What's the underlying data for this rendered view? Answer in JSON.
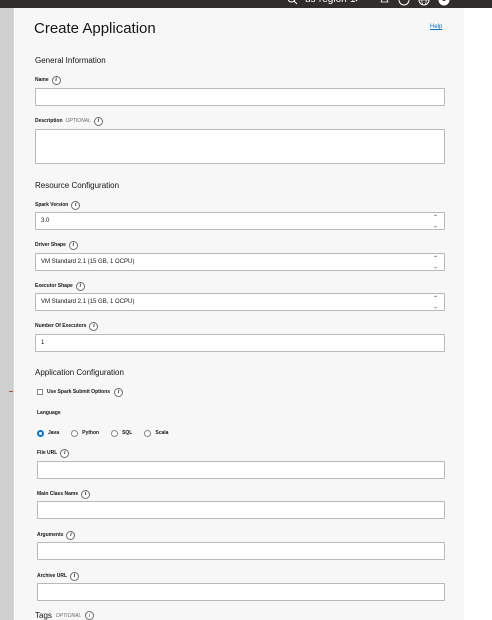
{
  "topbar": {
    "region": "us-region-1"
  },
  "page": {
    "title": "Create Application",
    "help": "Help"
  },
  "general": {
    "heading": "General Information",
    "name_label": "Name",
    "name_value": "",
    "description_label": "Description",
    "description_optional": "OPTIONAL",
    "description_value": ""
  },
  "resource": {
    "heading": "Resource Configuration",
    "spark_version_label": "Spark Version",
    "spark_version_value": "3.0",
    "driver_shape_label": "Driver Shape",
    "driver_shape_value": "VM Standard 2.1 (15 GB, 1 OCPU)",
    "executor_shape_label": "Executor Shape",
    "executor_shape_value": "VM Standard 2.1 (15 GB, 1 OCPU)",
    "num_executors_label": "Number Of Executors",
    "num_executors_value": "1"
  },
  "application": {
    "heading": "Application Configuration",
    "spark_submit_label": "Use Spark Submit Options",
    "language_label": "Language",
    "languages": [
      "Java",
      "Python",
      "SQL",
      "Scala"
    ],
    "selected_language": "Java",
    "file_url_label": "File URL",
    "main_class_label": "Main Class Name",
    "arguments_label": "Arguments",
    "archive_url_label": "Archive URL"
  },
  "tags": {
    "heading": "Tags",
    "optional": "OPTIONAL"
  },
  "colors": {
    "accent": "#0572ce",
    "topbar": "#312d2a",
    "annotation_arrow": "#c74634"
  }
}
